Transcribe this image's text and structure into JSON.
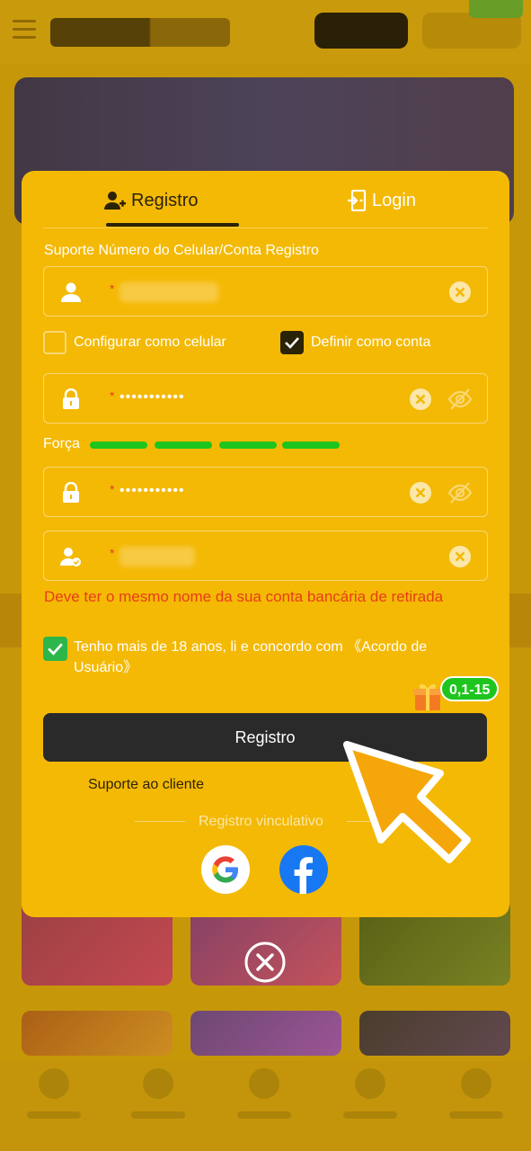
{
  "colors": {
    "modal_bg": "#f4b905",
    "dark": "#2b2307",
    "error": "#e83c1a",
    "strength_bar": "#1ec51e",
    "button_bg": "#2b2a2a"
  },
  "tabs": {
    "register_label": "Registro",
    "login_label": "Login"
  },
  "form": {
    "section_label": "Suporte Número do Celular/Conta Registro",
    "account_field": {
      "icon": "user-icon",
      "value": ""
    },
    "option_phone": {
      "label": "Configurar como celular",
      "checked": false
    },
    "option_account": {
      "label": "Definir como conta",
      "checked": true
    },
    "password_field": {
      "icon": "lock-icon",
      "value": "•••••••••••"
    },
    "strength": {
      "label": "Força",
      "level": 4,
      "max": 4
    },
    "confirm_password_field": {
      "icon": "lock-icon",
      "value": "•••••••••••"
    },
    "name_field": {
      "icon": "user-check-icon",
      "value": ""
    },
    "name_hint": "Deve ter o mesmo nome da sua conta bancária de retirada",
    "terms": {
      "text": "Tenho mais de 18 anos, li e concordo com 《Acordo de Usuário》",
      "checked": true
    },
    "promo_badge": "0,1-15",
    "submit_label": "Registro",
    "support_label": "Suporte ao cliente",
    "divider_label": "Registro vinculativo",
    "social": [
      "google-icon",
      "facebook-icon"
    ]
  }
}
